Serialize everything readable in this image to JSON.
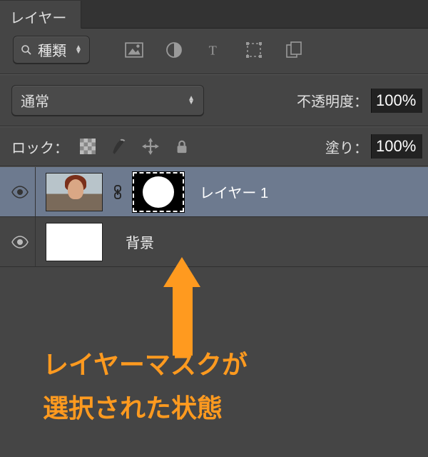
{
  "panel": {
    "tab_label": "レイヤー"
  },
  "filter": {
    "label": "種類"
  },
  "blend": {
    "mode": "通常",
    "opacity_label": "不透明度：",
    "opacity_value": "100%"
  },
  "lock": {
    "label": "ロック：",
    "fill_label": "塗り：",
    "fill_value": "100%"
  },
  "layers": [
    {
      "name": "レイヤー 1"
    },
    {
      "name": "背景"
    }
  ],
  "annotation": {
    "line1": "レイヤーマスクが",
    "line2": "選択された状態"
  }
}
